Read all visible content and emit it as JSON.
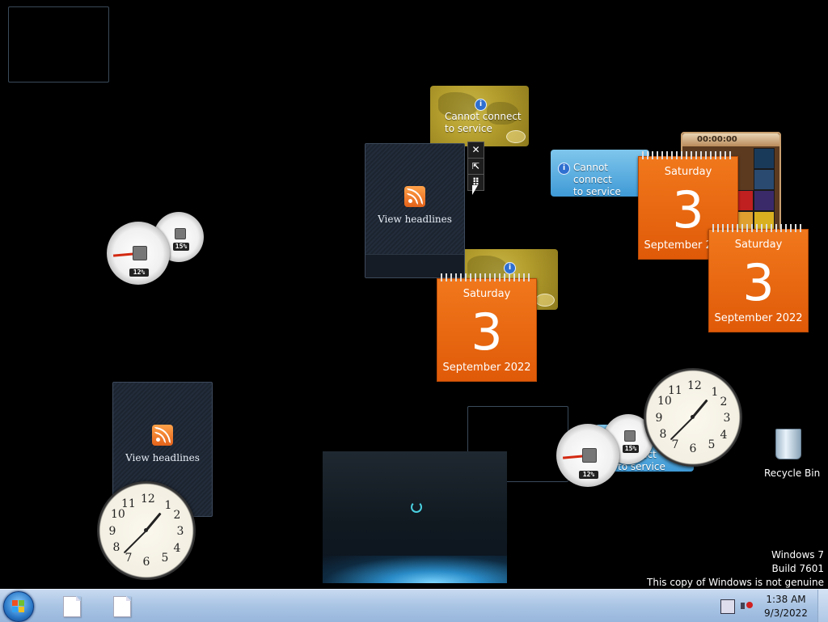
{
  "gadgets": {
    "feed_label": "View headlines",
    "connect_msg_line1": "Cannot connect",
    "connect_msg_line2": "to service",
    "calendar": {
      "weekday": "Saturday",
      "day": "3",
      "month_year": "September 2022"
    },
    "cpu_meter": {
      "cpu_pct": "12%",
      "mem_pct": "15%"
    },
    "puzzle_timer": "00:00:00",
    "info_glyph": "i"
  },
  "controls": {
    "close": "✕",
    "expand": "⇱",
    "drag": "⠿"
  },
  "desktop": {
    "recycle_bin": "Recycle Bin"
  },
  "watermark": {
    "line1": "Windows 7",
    "line2": "Build 7601",
    "line3": "This copy of Windows is not genuine"
  },
  "taskbar": {
    "time": "1:38 AM",
    "date": "9/3/2022"
  },
  "colors": {
    "calendar": "#e8650f",
    "taskbar": "#a9c4e4",
    "desktop": "#000000"
  }
}
